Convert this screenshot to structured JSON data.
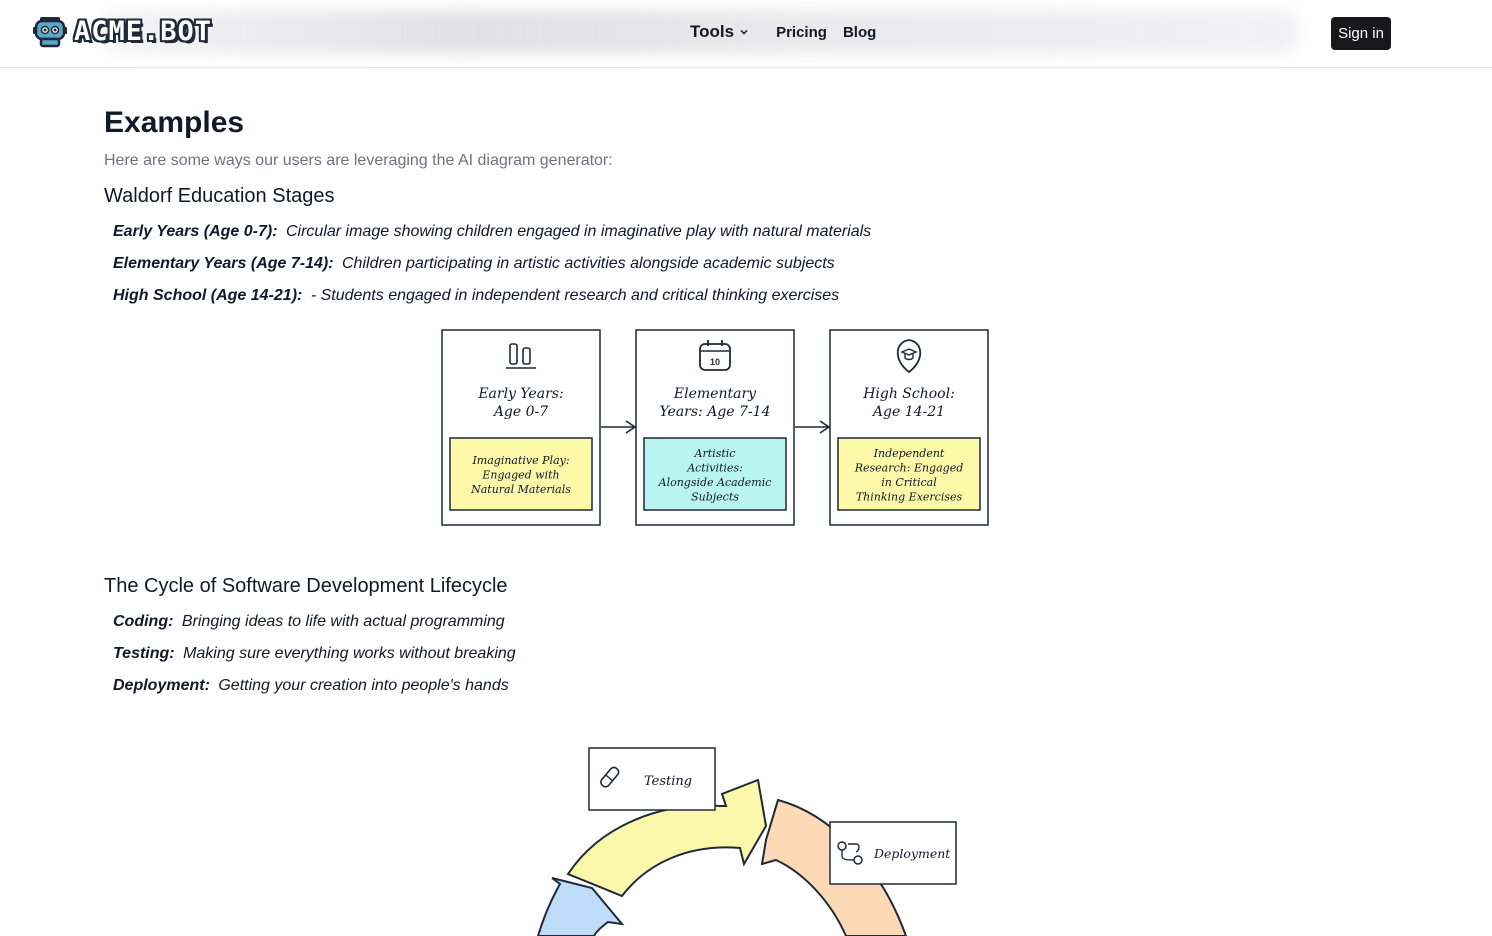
{
  "header": {
    "logo_text": "ACME.BOT",
    "nav": {
      "tools_label": "Tools",
      "pricing_label": "Pricing",
      "blog_label": "Blog"
    },
    "signin_label": "Sign in"
  },
  "main": {
    "title": "Examples",
    "intro": "Here are some ways our users are leveraging the AI diagram generator:",
    "sections": [
      {
        "heading": "Waldorf Education Stages",
        "items": [
          {
            "label": "Early Years (Age 0-7):",
            "text": "Circular image showing children engaged in imaginative play with natural materials"
          },
          {
            "label": "Elementary Years (Age 7-14):",
            "text": "Children participating in artistic activities alongside academic subjects"
          },
          {
            "label": "High School (Age 14-21):",
            "text": "- Students engaged in independent research and critical thinking exercises"
          }
        ],
        "diagram": {
          "cards": [
            {
              "title_line1": "Early Years:",
              "title_line2": "Age 0-7",
              "note": [
                "Imaginative Play:",
                "Engaged with",
                "Natural Materials"
              ],
              "note_color": "#fdf9a8",
              "icon": "bar-chart-icon"
            },
            {
              "title_line1": "Elementary",
              "title_line2": "Years: Age 7-14",
              "note": [
                "Artistic",
                "Activities:",
                "Alongside Academic",
                "Subjects"
              ],
              "note_color": "#b8f5f0",
              "icon": "calendar-icon",
              "icon_text": "10"
            },
            {
              "title_line1": "High School:",
              "title_line2": "Age 14-21",
              "note": [
                "Independent",
                "Research: Engaged",
                "in Critical",
                "Thinking Exercises"
              ],
              "note_color": "#fdf9a8",
              "icon": "graduation-badge-icon"
            }
          ]
        }
      },
      {
        "heading": "The Cycle of Software Development Lifecycle",
        "items": [
          {
            "label": "Coding:",
            "text": "Bringing ideas to life with actual programming"
          },
          {
            "label": "Testing:",
            "text": "Making sure everything works without breaking"
          },
          {
            "label": "Deployment:",
            "text": "Getting your creation into people's hands"
          }
        ],
        "diagram": {
          "labels": {
            "testing": "Testing",
            "deployment": "Deployment"
          },
          "colors": {
            "testing": "#fbf7ab",
            "deployment": "#fdd9b5",
            "coding": "#bfdcfb"
          }
        }
      }
    ]
  }
}
